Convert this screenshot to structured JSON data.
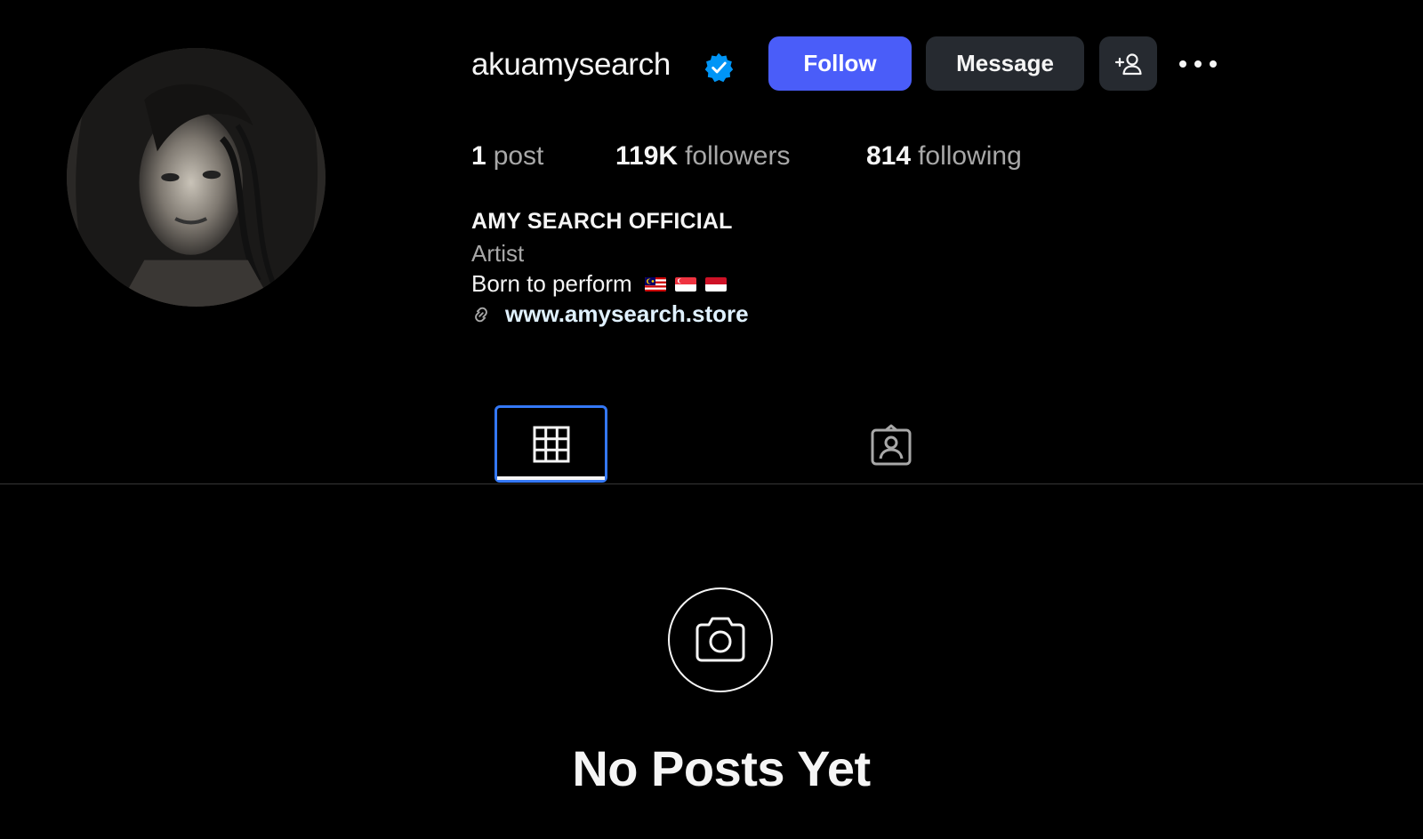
{
  "profile": {
    "username": "akuamysearch",
    "full_name": "AMY SEARCH OFFICIAL",
    "category": "Artist",
    "bio": "Born to perform",
    "bio_flags": [
      "malaysia-flag",
      "singapore-flag",
      "indonesia-flag"
    ],
    "link": "www.amysearch.store",
    "verified": true
  },
  "actions": {
    "follow_label": "Follow",
    "message_label": "Message"
  },
  "stats": {
    "posts": {
      "count": "1",
      "label": "post"
    },
    "followers": {
      "count": "119K",
      "label": "followers"
    },
    "following": {
      "count": "814",
      "label": "following"
    }
  },
  "tabs": [
    {
      "icon": "grid-icon",
      "active": true
    },
    {
      "icon": "tagged-icon",
      "active": false
    }
  ],
  "empty_state": {
    "icon": "camera-icon",
    "title": "No Posts Yet"
  },
  "colors": {
    "background": "#000000",
    "follow_button": "#4a5df9",
    "secondary_button": "#262a30",
    "verified_badge": "#0095f6",
    "focus_outline": "#3478f6",
    "muted_text": "#a8a8a8",
    "link_text": "#e0f1ff"
  }
}
